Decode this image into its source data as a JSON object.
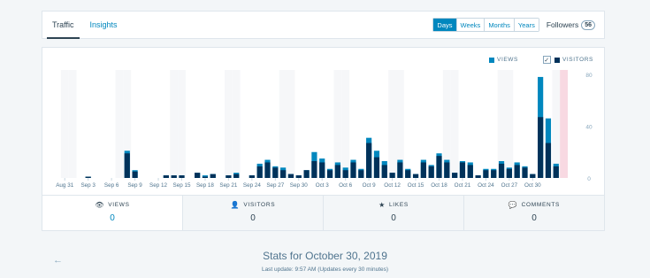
{
  "header": {
    "tabs": [
      "Traffic",
      "Insights"
    ],
    "periods": [
      "Days",
      "Weeks",
      "Months",
      "Years"
    ],
    "active_period": "Days",
    "followers_label": "Followers",
    "followers_count": "56"
  },
  "legend": {
    "views": "VIEWS",
    "visitors": "VISITORS",
    "visitors_checked": true,
    "check": "✓"
  },
  "colors": {
    "views": "#0087be",
    "visitors": "#00325a",
    "today": "#f8d9e2",
    "weekend": "#f6f7f9"
  },
  "chart_data": {
    "type": "bar",
    "y_ticks": [
      "80",
      "40",
      "0"
    ],
    "ylim": [
      0,
      80
    ],
    "x_tick_labels": [
      "Aug 31",
      "Sep 3",
      "Sep 6",
      "Sep 9",
      "Sep 12",
      "Sep 15",
      "Sep 18",
      "Sep 21",
      "Sep 24",
      "Sep 27",
      "Sep 30",
      "Oct 3",
      "Oct 6",
      "Oct 9",
      "Oct 12",
      "Oct 15",
      "Oct 18",
      "Oct 21",
      "Oct 24",
      "Oct 27",
      "Oct 30"
    ],
    "series": [
      {
        "name": "VIEWS",
        "values": [
          0,
          0,
          0,
          0,
          1,
          0,
          0,
          0,
          0,
          21,
          6,
          0,
          0,
          0,
          2,
          2,
          2,
          0,
          4,
          2,
          3,
          0,
          2,
          4,
          0,
          2,
          11,
          14,
          9,
          8,
          3,
          2,
          6,
          20,
          15,
          7,
          12,
          8,
          14,
          7,
          31,
          21,
          13,
          4,
          14,
          7,
          3,
          14,
          10,
          19,
          14,
          4,
          13,
          12,
          2,
          7,
          7,
          13,
          8,
          12,
          9,
          3,
          78,
          46,
          11,
          0
        ]
      },
      {
        "name": "VISITORS",
        "values": [
          0,
          0,
          0,
          0,
          1,
          0,
          0,
          0,
          0,
          19,
          5,
          0,
          0,
          0,
          2,
          2,
          2,
          0,
          4,
          1,
          3,
          0,
          2,
          3,
          0,
          2,
          9,
          12,
          8,
          6,
          3,
          2,
          6,
          13,
          12,
          6,
          10,
          6,
          12,
          6,
          27,
          16,
          10,
          4,
          12,
          6,
          3,
          12,
          9,
          17,
          12,
          4,
          12,
          10,
          2,
          6,
          6,
          11,
          7,
          10,
          8,
          3,
          47,
          27,
          9,
          0
        ]
      }
    ]
  },
  "stats": [
    {
      "icon": "👁",
      "label": "VIEWS",
      "value": "0"
    },
    {
      "icon": "👤",
      "label": "VISITORS",
      "value": "0"
    },
    {
      "icon": "★",
      "label": "LIKES",
      "value": "0"
    },
    {
      "icon": "💬",
      "label": "COMMENTS",
      "value": "0"
    }
  ],
  "footer": {
    "back": "←",
    "title": "Stats for October 30, 2019",
    "subtitle": "Last update: 9:57 AM (Updates every 30 minutes)"
  }
}
